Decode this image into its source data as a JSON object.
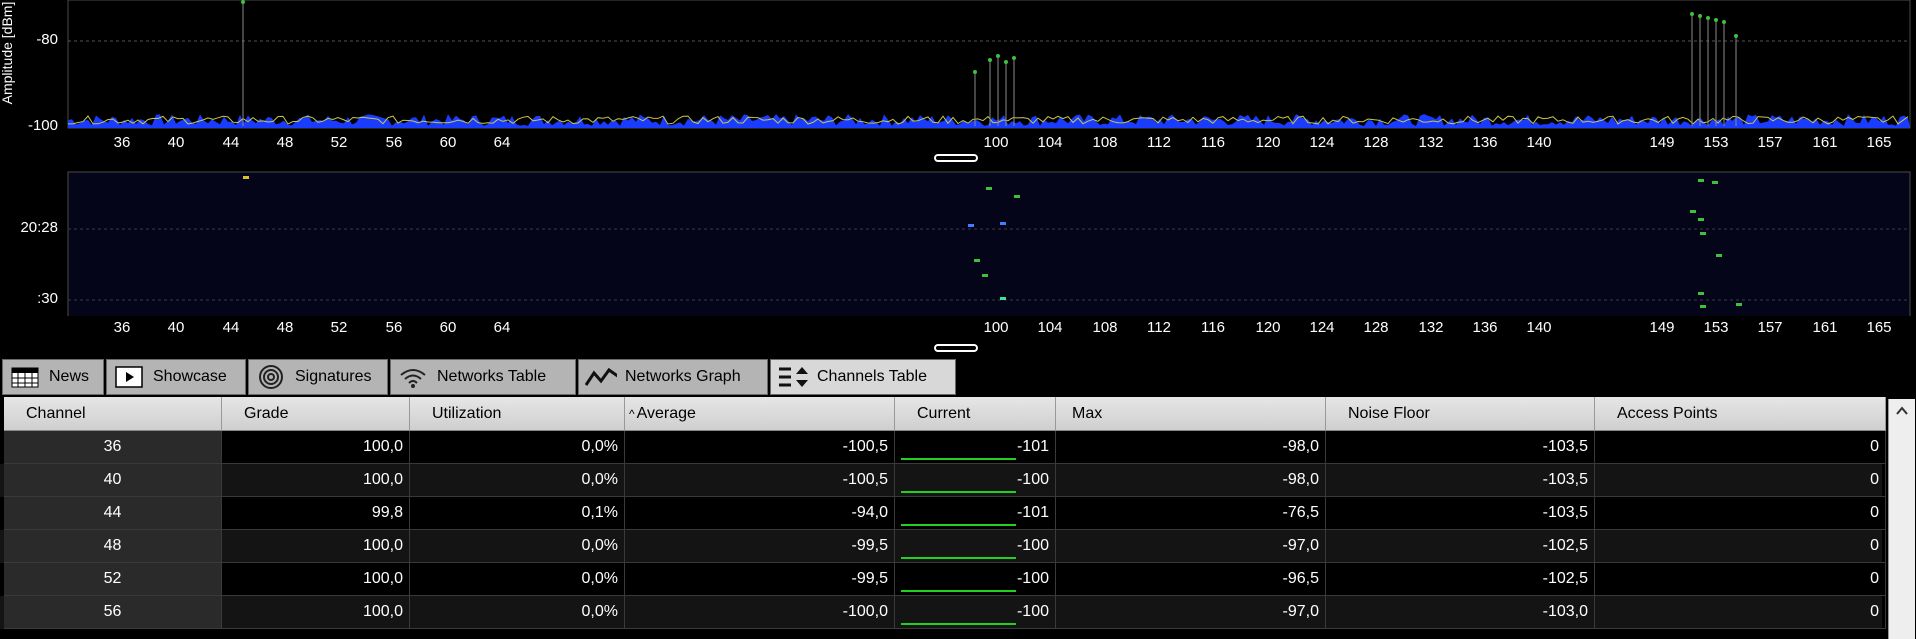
{
  "spectrum": {
    "y_axis_title": "Amplitude [dBm]",
    "y_labels": [
      "-80",
      "-100"
    ],
    "channel_ticks": [
      "36",
      "40",
      "44",
      "48",
      "52",
      "56",
      "60",
      "64",
      "100",
      "104",
      "108",
      "112",
      "116",
      "120",
      "124",
      "128",
      "132",
      "136",
      "140",
      "149",
      "153",
      "157",
      "161",
      "165"
    ]
  },
  "waterfall": {
    "time_labels": [
      "20:28",
      ":30"
    ],
    "channel_ticks": [
      "36",
      "40",
      "44",
      "48",
      "52",
      "56",
      "60",
      "64",
      "100",
      "104",
      "108",
      "112",
      "116",
      "120",
      "124",
      "128",
      "132",
      "136",
      "140",
      "149",
      "153",
      "157",
      "161",
      "165"
    ]
  },
  "tabs": [
    {
      "label": "News",
      "icon": "calendar-grid-icon"
    },
    {
      "label": "Showcase",
      "icon": "play-icon"
    },
    {
      "label": "Signatures",
      "icon": "signal-arcs-icon"
    },
    {
      "label": "Networks Table",
      "icon": "wifi-icon"
    },
    {
      "label": "Networks Graph",
      "icon": "graph-line-icon"
    },
    {
      "label": "Channels Table",
      "icon": "sort-list-icon",
      "active": true
    }
  ],
  "table": {
    "columns": [
      "Channel",
      "Grade",
      "Utilization",
      "Average",
      "Current",
      "Max",
      "Noise Floor",
      "Access Points"
    ],
    "sort_indicator": "^",
    "rows": [
      {
        "channel": "36",
        "grade": "100,0",
        "utilization": "0,0%",
        "average": "-100,5",
        "current": "-101",
        "max": "-98,0",
        "noise_floor": "-103,5",
        "access_points": "0"
      },
      {
        "channel": "40",
        "grade": "100,0",
        "utilization": "0,0%",
        "average": "-100,5",
        "current": "-100",
        "max": "-98,0",
        "noise_floor": "-103,5",
        "access_points": "0"
      },
      {
        "channel": "44",
        "grade": "99,8",
        "utilization": "0,1%",
        "average": "-94,0",
        "current": "-101",
        "max": "-76,5",
        "noise_floor": "-103,5",
        "access_points": "0"
      },
      {
        "channel": "48",
        "grade": "100,0",
        "utilization": "0,0%",
        "average": "-99,5",
        "current": "-100",
        "max": "-97,0",
        "noise_floor": "-102,5",
        "access_points": "0"
      },
      {
        "channel": "52",
        "grade": "100,0",
        "utilization": "0,0%",
        "average": "-99,5",
        "current": "-100",
        "max": "-96,5",
        "noise_floor": "-102,5",
        "access_points": "0"
      },
      {
        "channel": "56",
        "grade": "100,0",
        "utilization": "0,0%",
        "average": "-100,0",
        "current": "-100",
        "max": "-97,0",
        "noise_floor": "-103,0",
        "access_points": "0"
      }
    ]
  },
  "colors": {
    "spectrum_fill": "#1a3cff",
    "grid": "#555555",
    "current_bar": "#22d022",
    "peak_green": "#3fbf3f"
  }
}
